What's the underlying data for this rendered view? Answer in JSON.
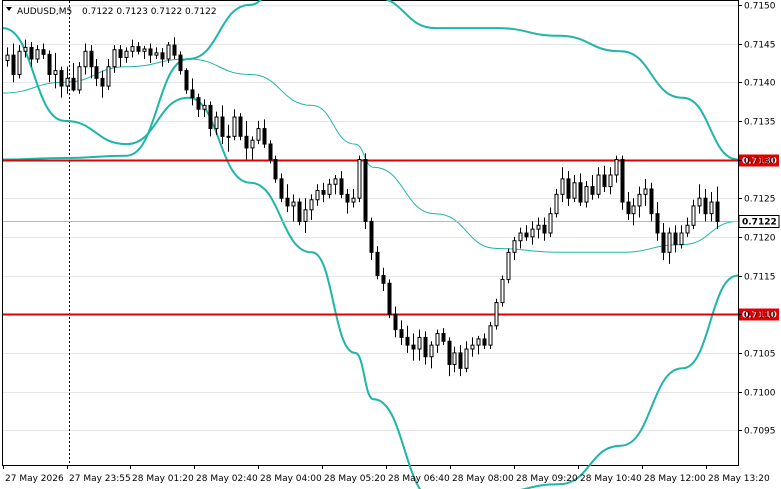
{
  "header": {
    "symbol_info": "AUDUSD,M5",
    "ohlc": "0.7122 0.7123 0.7122 0.7122"
  },
  "chart_data": {
    "type": "candlestick",
    "symbol": "AUDUSD",
    "timeframe": "M5",
    "ylim": [
      0.70905,
      0.71505
    ],
    "y_ticks": [
      "0.7150",
      "0.7145",
      "0.7140",
      "0.7135",
      "0.7130",
      "0.7125",
      "0.7120",
      "0.7115",
      "0.7110",
      "0.7105",
      "0.7100",
      "0.7095"
    ],
    "x_ticks": [
      "27 May 2026",
      "27 May 23:55",
      "28 May 01:20",
      "28 May 02:40",
      "28 May 04:00",
      "28 May 05:20",
      "28 May 06:40",
      "28 May 08:00",
      "28 May 09:20",
      "28 May 10:40",
      "28 May 12:00",
      "28 May 13:20"
    ],
    "horizontal_lines": [
      {
        "value": 0.713,
        "label": "0.7130",
        "color": "#e00000"
      },
      {
        "value": 0.711,
        "label": "0.7110",
        "color": "#e00000"
      }
    ],
    "current_price": {
      "value": 0.7122,
      "label": "0.7122"
    },
    "indicator": "Bollinger Bands",
    "series": [
      {
        "name": "upper",
        "color": "#1fb5a8",
        "x": [
          0,
          10,
          20,
          30,
          40,
          50,
          57,
          60,
          70,
          80,
          90,
          100,
          110,
          119
        ],
        "values": [
          0.713,
          0.71302,
          0.71305,
          0.7143,
          0.715,
          0.7164,
          0.7162,
          0.7151,
          0.7147,
          0.7147,
          0.7146,
          0.7144,
          0.7138,
          0.713
        ]
      },
      {
        "name": "middle",
        "color": "#1fb5a8",
        "x": [
          0,
          10,
          20,
          30,
          40,
          50,
          57,
          60,
          70,
          80,
          90,
          100,
          110,
          119
        ],
        "values": [
          0.71386,
          0.714,
          0.7142,
          0.7143,
          0.7141,
          0.7137,
          0.7132,
          0.7129,
          0.7123,
          0.71185,
          0.7118,
          0.7118,
          0.7119,
          0.7122
        ]
      },
      {
        "name": "lower",
        "color": "#1fb5a8",
        "x": [
          0,
          10,
          20,
          30,
          40,
          50,
          57,
          60,
          70,
          80,
          90,
          100,
          110,
          119
        ],
        "values": [
          0.7147,
          0.7135,
          0.7132,
          0.7138,
          0.7127,
          0.7118,
          0.7105,
          0.7099,
          0.7086,
          0.7087,
          0.7088,
          0.7093,
          0.7103,
          0.7115
        ]
      }
    ],
    "candles_ohlc": [
      [
        0.71428,
        0.71445,
        0.7142,
        0.71435
      ],
      [
        0.71435,
        0.7145,
        0.714,
        0.7141
      ],
      [
        0.7141,
        0.71448,
        0.71405,
        0.7144
      ],
      [
        0.7144,
        0.71455,
        0.71432,
        0.71445
      ],
      [
        0.71445,
        0.71452,
        0.7142,
        0.7143
      ],
      [
        0.7143,
        0.71448,
        0.71425,
        0.71442
      ],
      [
        0.71442,
        0.7145,
        0.7143,
        0.71436
      ],
      [
        0.71436,
        0.71441,
        0.714,
        0.7141
      ],
      [
        0.7141,
        0.71438,
        0.71392,
        0.71415
      ],
      [
        0.71415,
        0.7142,
        0.7138,
        0.71395
      ],
      [
        0.71395,
        0.7142,
        0.71385,
        0.71405
      ],
      [
        0.71405,
        0.71425,
        0.71388,
        0.7139
      ],
      [
        0.7139,
        0.71426,
        0.71385,
        0.7142
      ],
      [
        0.7142,
        0.7145,
        0.7141,
        0.7144
      ],
      [
        0.7144,
        0.71448,
        0.71405,
        0.7142
      ],
      [
        0.7142,
        0.7143,
        0.71395,
        0.71405
      ],
      [
        0.71405,
        0.71415,
        0.7138,
        0.71395
      ],
      [
        0.71395,
        0.7143,
        0.7139,
        0.7142
      ],
      [
        0.7142,
        0.71448,
        0.71412,
        0.71442
      ],
      [
        0.71442,
        0.71448,
        0.7142,
        0.71432
      ],
      [
        0.71432,
        0.71445,
        0.71425,
        0.7144
      ],
      [
        0.7144,
        0.71455,
        0.71432,
        0.71446
      ],
      [
        0.71446,
        0.71452,
        0.71436,
        0.7144
      ],
      [
        0.7144,
        0.71447,
        0.7143,
        0.71443
      ],
      [
        0.71443,
        0.7145,
        0.71425,
        0.71435
      ],
      [
        0.71435,
        0.71445,
        0.7143,
        0.71438
      ],
      [
        0.71438,
        0.71444,
        0.7142,
        0.7143
      ],
      [
        0.7143,
        0.71452,
        0.71425,
        0.71448
      ],
      [
        0.71448,
        0.71458,
        0.7143,
        0.71435
      ],
      [
        0.71435,
        0.7144,
        0.7141,
        0.71415
      ],
      [
        0.71415,
        0.71418,
        0.71385,
        0.7139
      ],
      [
        0.7139,
        0.71405,
        0.7137,
        0.7138
      ],
      [
        0.7138,
        0.71385,
        0.71355,
        0.71365
      ],
      [
        0.71365,
        0.71378,
        0.71355,
        0.7137
      ],
      [
        0.7137,
        0.71375,
        0.7133,
        0.7134
      ],
      [
        0.7134,
        0.71362,
        0.71332,
        0.71355
      ],
      [
        0.71355,
        0.7137,
        0.7132,
        0.7133
      ],
      [
        0.7133,
        0.71345,
        0.7131,
        0.7133
      ],
      [
        0.7133,
        0.71365,
        0.71325,
        0.71355
      ],
      [
        0.71355,
        0.7136,
        0.71325,
        0.7133
      ],
      [
        0.7133,
        0.7135,
        0.713,
        0.71315
      ],
      [
        0.71315,
        0.7133,
        0.713,
        0.71325
      ],
      [
        0.71325,
        0.7135,
        0.7132,
        0.7134
      ],
      [
        0.7134,
        0.71352,
        0.71315,
        0.7132
      ],
      [
        0.7132,
        0.71325,
        0.71295,
        0.713
      ],
      [
        0.713,
        0.71305,
        0.7127,
        0.71275
      ],
      [
        0.71275,
        0.71282,
        0.71245,
        0.7125
      ],
      [
        0.7125,
        0.71268,
        0.71232,
        0.7124
      ],
      [
        0.7124,
        0.71255,
        0.7122,
        0.71245
      ],
      [
        0.71245,
        0.7125,
        0.71215,
        0.7122
      ],
      [
        0.7122,
        0.7125,
        0.71205,
        0.71235
      ],
      [
        0.71235,
        0.71255,
        0.71222,
        0.71248
      ],
      [
        0.71248,
        0.71268,
        0.7124,
        0.7126
      ],
      [
        0.7126,
        0.7127,
        0.71245,
        0.71255
      ],
      [
        0.71255,
        0.71275,
        0.7125,
        0.71268
      ],
      [
        0.71268,
        0.7128,
        0.71255,
        0.71275
      ],
      [
        0.71275,
        0.71285,
        0.7125,
        0.71255
      ],
      [
        0.71255,
        0.71262,
        0.7123,
        0.71245
      ],
      [
        0.71245,
        0.71262,
        0.71238,
        0.7125
      ],
      [
        0.7125,
        0.71305,
        0.71245,
        0.713
      ],
      [
        0.713,
        0.71308,
        0.7121,
        0.7122
      ],
      [
        0.7122,
        0.71225,
        0.7117,
        0.7118
      ],
      [
        0.7118,
        0.71188,
        0.71145,
        0.7115
      ],
      [
        0.7115,
        0.7116,
        0.7113,
        0.7114
      ],
      [
        0.7114,
        0.71145,
        0.71095,
        0.711
      ],
      [
        0.711,
        0.7111,
        0.7107,
        0.7108
      ],
      [
        0.7108,
        0.71092,
        0.7106,
        0.7107
      ],
      [
        0.7107,
        0.71085,
        0.7105,
        0.7106
      ],
      [
        0.7106,
        0.71075,
        0.7104,
        0.71055
      ],
      [
        0.71055,
        0.7108,
        0.7104,
        0.7107
      ],
      [
        0.7107,
        0.71078,
        0.71035,
        0.71045
      ],
      [
        0.71045,
        0.71065,
        0.7103,
        0.7106
      ],
      [
        0.7106,
        0.7108,
        0.7105,
        0.71075
      ],
      [
        0.71075,
        0.71082,
        0.7106,
        0.71065
      ],
      [
        0.71065,
        0.7107,
        0.7102,
        0.71035
      ],
      [
        0.71035,
        0.71058,
        0.71025,
        0.7105
      ],
      [
        0.7105,
        0.7106,
        0.7102,
        0.7103
      ],
      [
        0.7103,
        0.71065,
        0.71025,
        0.71055
      ],
      [
        0.71055,
        0.7107,
        0.71045,
        0.7106
      ],
      [
        0.7106,
        0.71072,
        0.71048,
        0.71068
      ],
      [
        0.71068,
        0.71075,
        0.71055,
        0.7106
      ],
      [
        0.7106,
        0.7109,
        0.71055,
        0.71085
      ],
      [
        0.71085,
        0.7112,
        0.7108,
        0.71115
      ],
      [
        0.71115,
        0.7115,
        0.7111,
        0.71145
      ],
      [
        0.71145,
        0.71185,
        0.7114,
        0.7118
      ],
      [
        0.7118,
        0.712,
        0.7117,
        0.71195
      ],
      [
        0.71195,
        0.71212,
        0.71185,
        0.71205
      ],
      [
        0.71205,
        0.71215,
        0.71195,
        0.712
      ],
      [
        0.712,
        0.7122,
        0.7119,
        0.7121
      ],
      [
        0.7121,
        0.71225,
        0.71198,
        0.71215
      ],
      [
        0.71215,
        0.71225,
        0.71195,
        0.71205
      ],
      [
        0.71205,
        0.71238,
        0.712,
        0.7123
      ],
      [
        0.7123,
        0.71262,
        0.71225,
        0.71255
      ],
      [
        0.71255,
        0.7129,
        0.71245,
        0.71275
      ],
      [
        0.71275,
        0.71285,
        0.7124,
        0.7125
      ],
      [
        0.7125,
        0.7128,
        0.71245,
        0.7127
      ],
      [
        0.7127,
        0.71282,
        0.7124,
        0.71245
      ],
      [
        0.71245,
        0.71272,
        0.71238,
        0.71265
      ],
      [
        0.71265,
        0.7128,
        0.71248,
        0.71255
      ],
      [
        0.71255,
        0.7129,
        0.7125,
        0.7128
      ],
      [
        0.7128,
        0.71292,
        0.71258,
        0.71265
      ],
      [
        0.71265,
        0.7129,
        0.71255,
        0.7128
      ],
      [
        0.7128,
        0.71305,
        0.7127,
        0.713
      ],
      [
        0.713,
        0.71305,
        0.71235,
        0.71245
      ],
      [
        0.71245,
        0.71258,
        0.71222,
        0.7123
      ],
      [
        0.7123,
        0.7125,
        0.71215,
        0.7124
      ],
      [
        0.7124,
        0.71265,
        0.71225,
        0.71255
      ],
      [
        0.71255,
        0.71275,
        0.7124,
        0.71262
      ],
      [
        0.71262,
        0.7127,
        0.7122,
        0.7123
      ],
      [
        0.7123,
        0.71245,
        0.71195,
        0.71205
      ],
      [
        0.71205,
        0.71218,
        0.7117,
        0.7118
      ],
      [
        0.7118,
        0.71212,
        0.71165,
        0.71205
      ],
      [
        0.71205,
        0.71215,
        0.7118,
        0.7119
      ],
      [
        0.7119,
        0.71215,
        0.71185,
        0.71205
      ],
      [
        0.71205,
        0.71225,
        0.712,
        0.71215
      ],
      [
        0.71215,
        0.71248,
        0.7121,
        0.7124
      ],
      [
        0.7124,
        0.71268,
        0.7123,
        0.7125
      ],
      [
        0.7125,
        0.71262,
        0.7122,
        0.7123
      ],
      [
        0.7123,
        0.71258,
        0.7122,
        0.71245
      ],
      [
        0.71245,
        0.71265,
        0.7121,
        0.7122
      ]
    ]
  }
}
